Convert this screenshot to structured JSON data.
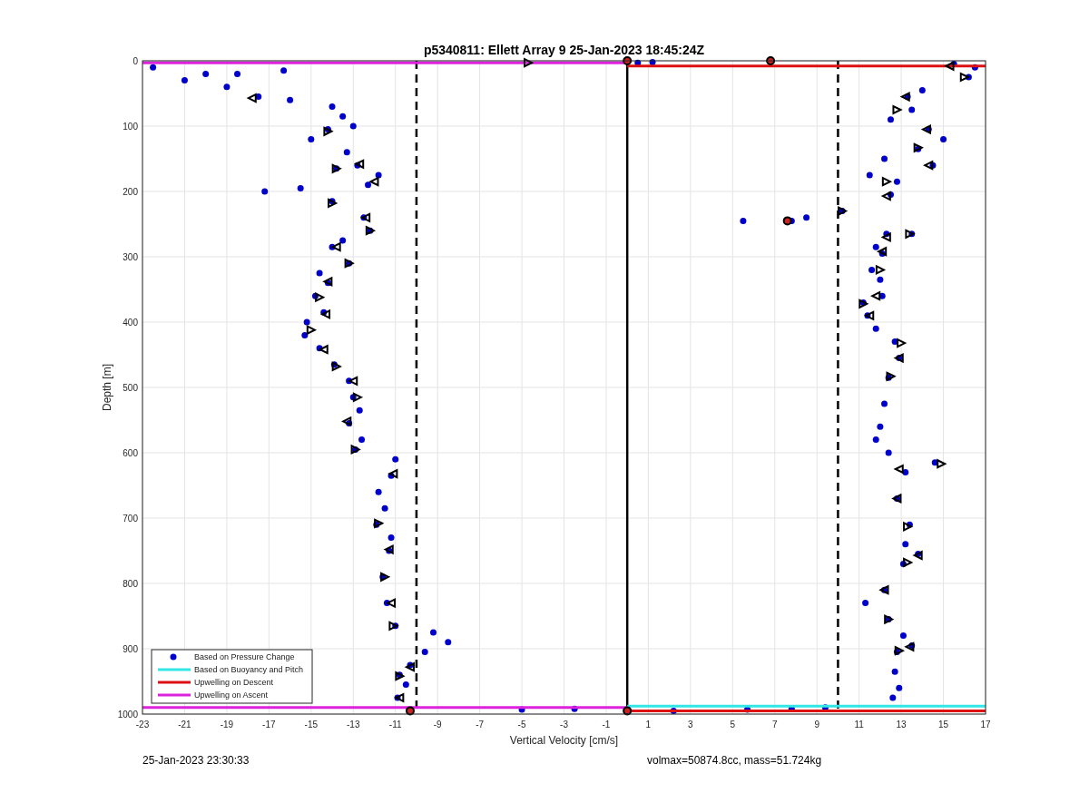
{
  "chart_data": {
    "type": "scatter",
    "title": "p5340811: Ellett Array 9 25-Jan-2023 18:45:24Z",
    "xlabel": "Vertical Velocity [cm/s]",
    "ylabel": "Depth [m]",
    "xlim": [
      -23,
      17
    ],
    "ylim": [
      1000,
      0
    ],
    "xticks": [
      -23,
      -21,
      -19,
      -17,
      -15,
      -13,
      -11,
      -9,
      -7,
      -5,
      -3,
      -1,
      1,
      3,
      5,
      7,
      9,
      11,
      13,
      15,
      17
    ],
    "yticks": [
      0,
      100,
      200,
      300,
      400,
      500,
      600,
      700,
      800,
      900,
      1000
    ],
    "grid": true,
    "legend": true,
    "ref_lines": [
      {
        "axis": "x",
        "value": -10
      },
      {
        "axis": "x",
        "value": 0
      },
      {
        "axis": "x",
        "value": 10
      }
    ],
    "series": [
      {
        "name": "Based on Pressure Change",
        "type": "scatter",
        "color": "#0000cc",
        "x": [
          -22.5,
          -21,
          -20,
          -19,
          -18.5,
          -17.5,
          -16.3,
          -16,
          -14,
          -13.5,
          -14.2,
          -13,
          -15,
          -13.3,
          -12.8,
          -11.8,
          -13.8,
          -17.2,
          -15.5,
          -12.3,
          -14,
          -12.5,
          -12.2,
          -13.5,
          -14,
          -13.2,
          -14.6,
          -14.2,
          -14.8,
          -14.4,
          -15.2,
          -15.3,
          -14.6,
          -13.9,
          -13.2,
          -13,
          -12.7,
          -13.2,
          -12.6,
          -12.9,
          -11,
          -11.2,
          -11.8,
          -11.5,
          -11.9,
          -11.2,
          -11.3,
          -11.6,
          -11.4,
          -11,
          -9.2,
          -8.5,
          -9.6,
          -10.3,
          -10.8,
          -10.5,
          -10.9,
          -5,
          -2.5,
          0.5,
          1.2,
          16.5,
          15.5,
          16.2,
          14,
          13.3,
          13.5,
          12.5,
          14.3,
          15,
          13.8,
          12.2,
          14.5,
          11.5,
          12.8,
          12.5,
          10.2,
          7.8,
          5.5,
          8.5,
          12.3,
          13.5,
          11.8,
          12.1,
          11.6,
          12,
          11.2,
          12.1,
          11.4,
          11.8,
          12.7,
          12.9,
          12.4,
          12.2,
          12,
          11.8,
          12.4,
          14.6,
          13.2,
          12.8,
          13.4,
          13.2,
          13.8,
          13.1,
          12.2,
          11.3,
          12.4,
          13.1,
          13.5,
          12.8,
          12.7,
          12.9,
          12.6,
          2.2,
          5.7,
          7.8,
          9.4
        ],
        "values": [
          10,
          30,
          20,
          40,
          20,
          55,
          15,
          60,
          70,
          85,
          105,
          100,
          120,
          140,
          160,
          175,
          165,
          200,
          195,
          190,
          215,
          240,
          260,
          275,
          285,
          310,
          325,
          340,
          360,
          385,
          400,
          420,
          440,
          465,
          490,
          515,
          535,
          555,
          580,
          595,
          610,
          635,
          660,
          685,
          710,
          730,
          750,
          790,
          830,
          865,
          875,
          890,
          905,
          925,
          940,
          955,
          975,
          993,
          992,
          3,
          2,
          10,
          5,
          25,
          45,
          55,
          75,
          90,
          105,
          120,
          135,
          150,
          160,
          175,
          185,
          205,
          230,
          245,
          245,
          240,
          265,
          265,
          285,
          295,
          320,
          335,
          370,
          360,
          390,
          410,
          430,
          455,
          485,
          525,
          560,
          580,
          600,
          615,
          630,
          670,
          710,
          740,
          755,
          770,
          810,
          830,
          855,
          880,
          895,
          905,
          935,
          960,
          975,
          995,
          993,
          992,
          990
        ]
      },
      {
        "name": "Based on Buoyancy and Pitch",
        "type": "line",
        "color": "#33e6e6",
        "x": [
          0,
          17
        ],
        "values": [
          988,
          988
        ]
      },
      {
        "name": "Upwelling on Descent",
        "type": "line",
        "color": "#dd1111",
        "x": [
          0,
          17
        ],
        "values": [
          8,
          8
        ]
      },
      {
        "name": "Upwelling on Ascent",
        "type": "line",
        "color": "#dd22dd",
        "x": [
          -23,
          0
        ],
        "values": [
          3,
          3
        ]
      },
      {
        "type": "line",
        "color": "#dd1111",
        "x": [
          0,
          17
        ],
        "values": [
          995,
          995
        ]
      },
      {
        "type": "line",
        "color": "#dd22dd",
        "x": [
          -23,
          0
        ],
        "values": [
          990,
          990
        ]
      },
      {
        "type": "scatter",
        "color": "#000000",
        "x": [
          -17.8,
          -14.2,
          -12.7,
          -13.8,
          -12,
          -14,
          -12.4,
          -12.2,
          -13.8,
          -13.2,
          -14.2,
          -14.6,
          -14.3,
          -15,
          -14.4,
          -13.8,
          -13,
          -12.8,
          -13.3,
          -12.9,
          -11.1,
          -11.8,
          -11.3,
          -11.5,
          -11.2,
          -11.1,
          -10.3,
          -10.8,
          -10.8,
          -4.7,
          15.3,
          16,
          13.2,
          12.8,
          14.2,
          13.8,
          14.3,
          12.3,
          12.3,
          10.2,
          12.3,
          13.4,
          12.1,
          12,
          11.8,
          11.2,
          11.5,
          13,
          12.9,
          12.5,
          12.9,
          14.9,
          12.8,
          13.3,
          13.8,
          13.3,
          12.2,
          12.4,
          13.4,
          12.9
        ],
        "values": [
          57,
          108,
          158,
          165,
          185,
          218,
          240,
          260,
          285,
          310,
          338,
          362,
          388,
          412,
          442,
          468,
          490,
          515,
          552,
          595,
          632,
          708,
          748,
          790,
          830,
          865,
          928,
          942,
          975,
          3,
          8,
          25,
          55,
          75,
          105,
          133,
          160,
          185,
          207,
          230,
          270,
          265,
          292,
          320,
          360,
          372,
          390,
          432,
          455,
          483,
          625,
          617,
          670,
          713,
          757,
          768,
          810,
          855,
          897,
          903
        ]
      },
      {
        "type": "scatter",
        "color": "#cc2222",
        "x": [
          0,
          6.8,
          7.6,
          -10.3,
          0
        ],
        "values": [
          0,
          0,
          245,
          995,
          995
        ]
      }
    ]
  },
  "footer": {
    "timestamp": "25-Jan-2023 23:30:33",
    "info": "volmax=50874.8cc, mass=51.724kg"
  }
}
